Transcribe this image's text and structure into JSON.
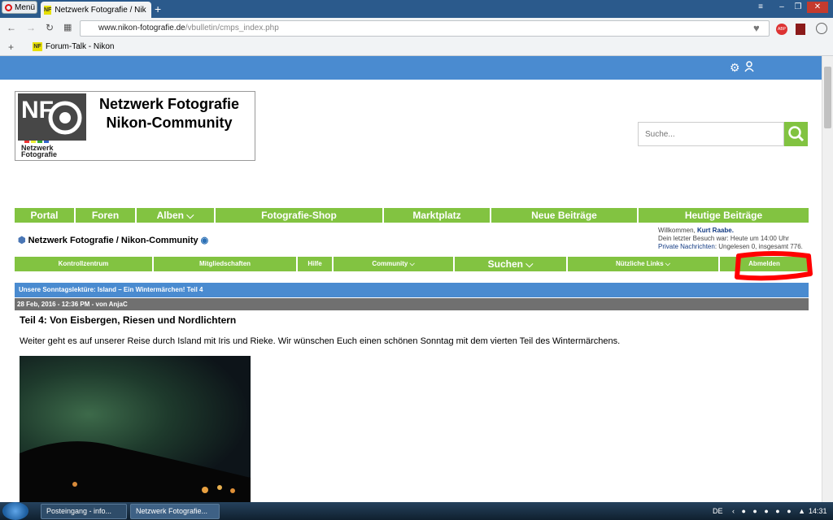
{
  "browser": {
    "menu_label": "Menü",
    "active_tab_title": "Netzwerk Fotografie / Nik",
    "url_host": "www.nikon-fotografie.de",
    "url_path": "/vbulletin/cmps_index.php",
    "bookmark_label": "Forum-Talk - Nikon"
  },
  "site": {
    "logo_line1": "Netzwerk Fotografie",
    "logo_line2": "Nikon-Community",
    "logo_mark": "NF",
    "logo_sub": "Netzwerk Fotografie",
    "search_placeholder": "Suche..."
  },
  "main_nav": [
    "Portal",
    "Foren",
    "Alben",
    "Fotografie-Shop",
    "Marktplatz",
    "Neue Beiträge",
    "Heutige Beiträge"
  ],
  "breadcrumb": "Netzwerk Fotografie / Nikon-Community",
  "welcome": {
    "greeting": "Willkommen,",
    "user": "Kurt Raabe.",
    "last_visit": "Dein letzter Besuch war: Heute um 14:00 Uhr",
    "pm_label": "Private Nachrichten",
    "pm_status": ": Ungelesen 0, insgesamt 776."
  },
  "sub_nav": [
    "Kontrollzentrum",
    "Mitgliedschaften",
    "Hilfe",
    "Community",
    "Suchen",
    "Nützliche Links",
    "Abmelden"
  ],
  "post": {
    "header": "Unsere Sonntagslektüre: Island – Ein Wintermärchen! Teil 4",
    "meta": "28 Feb, 2016 - 12:36 PM - von AnjaC",
    "title": "Teil 4: Von Eisbergen, Riesen und Nordlichtern",
    "body": "Weiter geht es auf unserer Reise durch Island mit Iris und Rieke. Wir wünschen Euch einen schönen Sonntag mit dem vierten Teil des Wintermärchens."
  },
  "taskbar": {
    "task1": "Posteingang - info...",
    "task2": "Netzwerk Fotografie...",
    "lang": "DE",
    "time": "14:31"
  },
  "colors": {
    "nav_green": "#82c341",
    "header_blue": "#4a8bd0",
    "meta_gray": "#707070",
    "highlight_red": "#ff0000"
  }
}
